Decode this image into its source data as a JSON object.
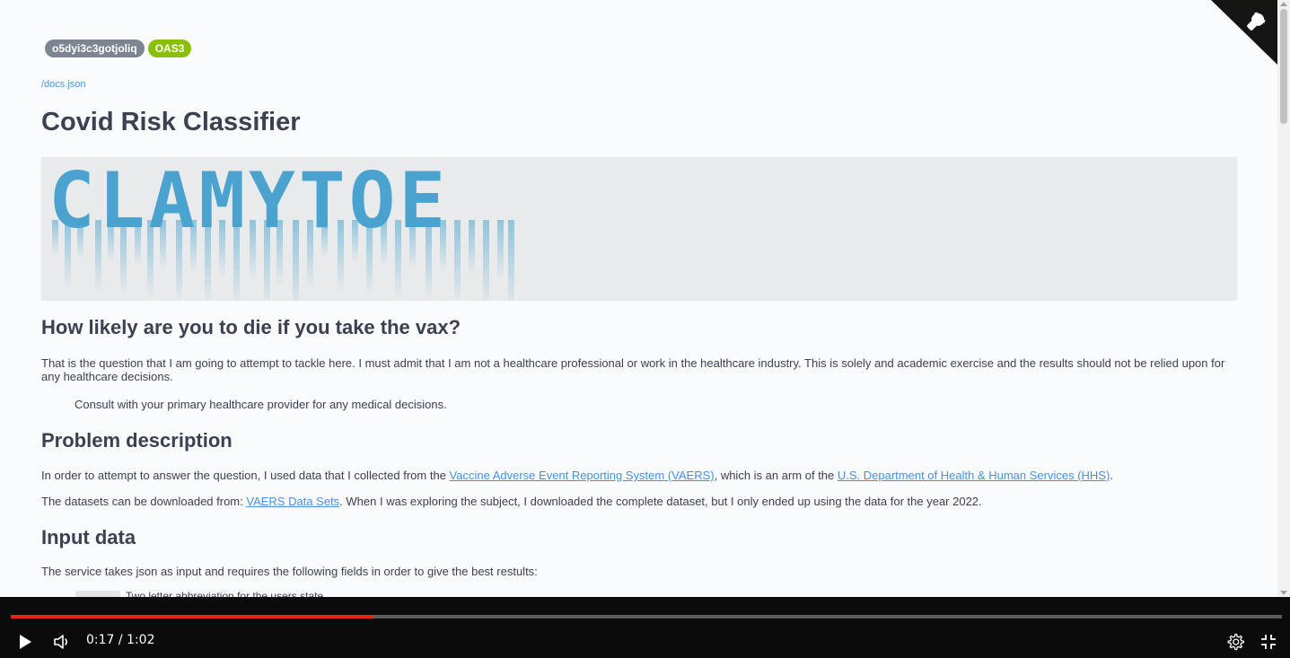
{
  "page": {
    "version_badge": "o5dyi3c3gotjoliq",
    "oas_badge": "OAS3",
    "docs_link": "/docs.json",
    "title": "Covid Risk Classifier",
    "banner_text": "CLAMYTOE"
  },
  "sections": {
    "likely_heading": "How likely are you to die if you take the vax?",
    "likely_p1": "That is the question that I am going to attempt to tackle here. I must admit that I am not a healthcare professional or work in the healthcare industry. This is solely and academic exercise and the results should not be relied upon for any healthcare decisions.",
    "likely_quote": "Consult with your primary healthcare provider for any medical decisions.",
    "problem_heading": "Problem description",
    "problem_p1_a": "In order to attempt to answer the question, I used data that I collected from the ",
    "problem_p1_link1": "Vaccine Adverse Event Reporting System (VAERS)",
    "problem_p1_b": ", which is an arm of the ",
    "problem_p1_link2": "U.S. Department of Health & Human Services (HHS)",
    "problem_p1_c": ".",
    "problem_p2_a": "The datasets can be downloaded from: ",
    "problem_p2_link": "VAERS Data Sets",
    "problem_p2_b": ". When I was exploring the subject, I downloaded the complete dataset, but I only ended up using the data for the year 2022.",
    "input_heading": "Input data",
    "input_p1": "The service takes json as input and requires the following fields in order to give the best restults:",
    "input_item_partial": "Two letter abbreviation for the users state"
  },
  "player": {
    "time_display": "0:17 / 1:02",
    "progress_fraction": 0.285,
    "icons": {
      "play": "play-icon",
      "volume": "volume-icon",
      "settings": "gear-icon",
      "exit_fullscreen": "exit-fullscreen-icon"
    },
    "accent": "#e52420"
  },
  "colors": {
    "banner_text": "#4aa3cf",
    "link": "#4990e2",
    "oas_badge": "#89bf04",
    "version_badge": "#7d8492"
  }
}
